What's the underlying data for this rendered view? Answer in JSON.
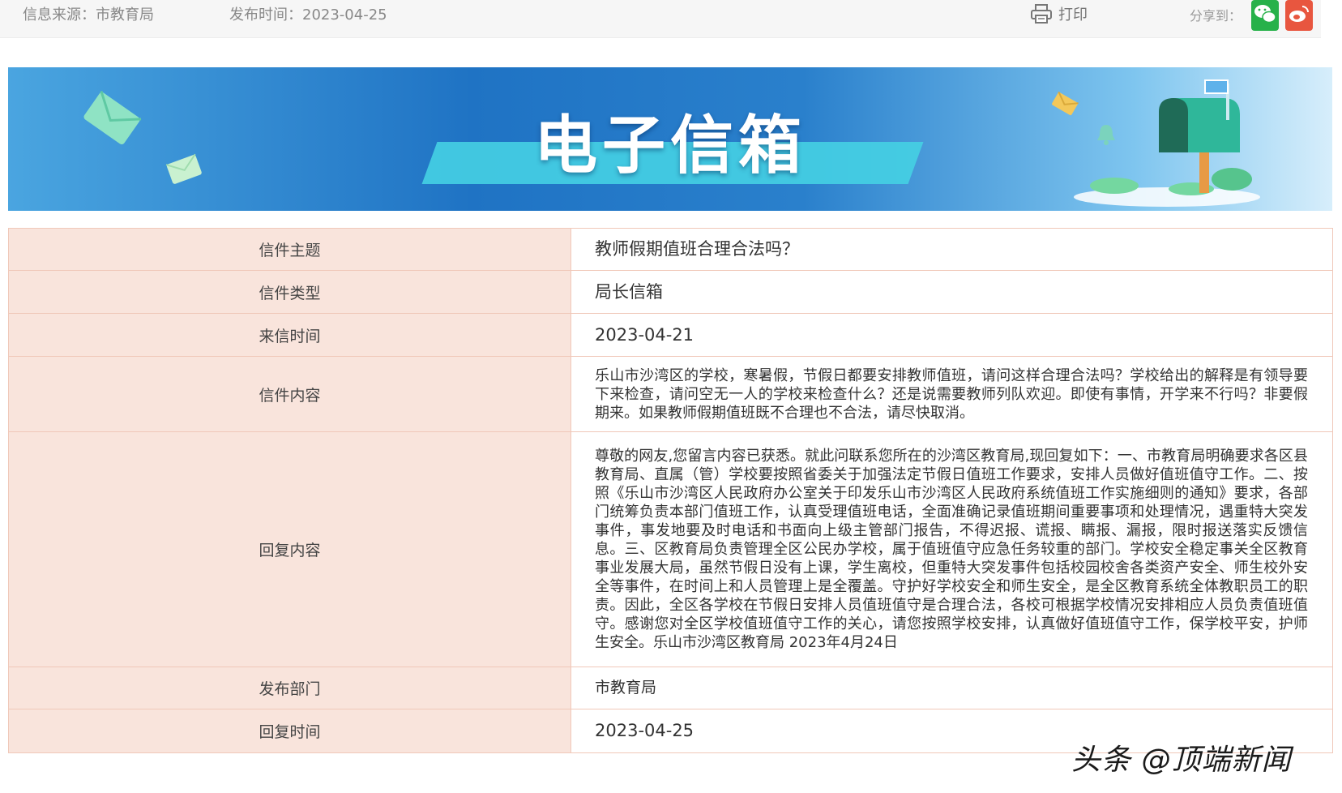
{
  "topbar": {
    "source_label": "信息来源：",
    "source_value": "市教育局",
    "publish_label": "发布时间：",
    "publish_value": "2023-04-25",
    "print_label": "打印",
    "share_label": "分享到："
  },
  "banner": {
    "title": "电子信箱"
  },
  "letter": {
    "rows": [
      {
        "label": "信件主题",
        "value": "教师假期值班合理合法吗？"
      },
      {
        "label": "信件类型",
        "value": "局长信箱"
      },
      {
        "label": "来信时间",
        "value": "2023-04-21"
      },
      {
        "label": "信件内容",
        "value": "乐山市沙湾区的学校，寒暑假，节假日都要安排教师值班，请问这样合理合法吗？学校给出的解释是有领导要下来检查，请问空无一人的学校来检查什么？还是说需要教师列队欢迎。即使有事情，开学来不行吗？非要假期来。如果教师假期值班既不合理也不合法，请尽快取消。"
      },
      {
        "label": "回复内容",
        "value": "尊敬的网友,您留言内容已获悉。就此问联系您所在的沙湾区教育局,现回复如下：一、市教育局明确要求各区县教育局、直属（管）学校要按照省委关于加强法定节假日值班工作要求，安排人员做好值班值守工作。二、按照《乐山市沙湾区人民政府办公室关于印发乐山市沙湾区人民政府系统值班工作实施细则的通知》要求，各部门统筹负责本部门值班工作，认真受理值班电话，全面准确记录值班期间重要事项和处理情况，遇重特大突发事件，事发地要及时电话和书面向上级主管部门报告，不得迟报、谎报、瞒报、漏报，限时报送落实反馈信息。三、区教育局负责管理全区公民办学校，属于值班值守应急任务较重的部门。学校安全稳定事关全区教育事业发展大局，虽然节假日没有上课，学生离校，但重特大突发事件包括校园校舍各类资产安全、师生校外安全等事件，在时间上和人员管理上是全覆盖。守护好学校安全和师生安全，是全区教育系统全体教职员工的职责。因此，全区各学校在节假日安排人员值班值守是合理合法，各校可根据学校情况安排相应人员负责值班值守。感谢您对全区学校值班值守工作的关心，请您按照学校安排，认真做好值班值守工作，保学校平安，护师生安全。乐山市沙湾区教育局 2023年4月24日"
      },
      {
        "label": "发布部门",
        "value": "市教育局"
      },
      {
        "label": "回复时间",
        "value": "2023-04-25"
      }
    ]
  },
  "watermark": "头条 @顶端新闻",
  "icons": {
    "print": "printer-icon",
    "wechat": "wechat-icon",
    "weibo": "weibo-icon",
    "decorations": [
      "envelope-icon",
      "mailbox-icon",
      "bell-icon"
    ]
  },
  "colors": {
    "label_bg": "#f9e4dc",
    "border": "#f0c8b9",
    "banner_blue": "#1f73c4",
    "stripe_cyan": "#45d0e3",
    "wechat_green": "#27b14a",
    "weibo_red": "#e8563f"
  }
}
